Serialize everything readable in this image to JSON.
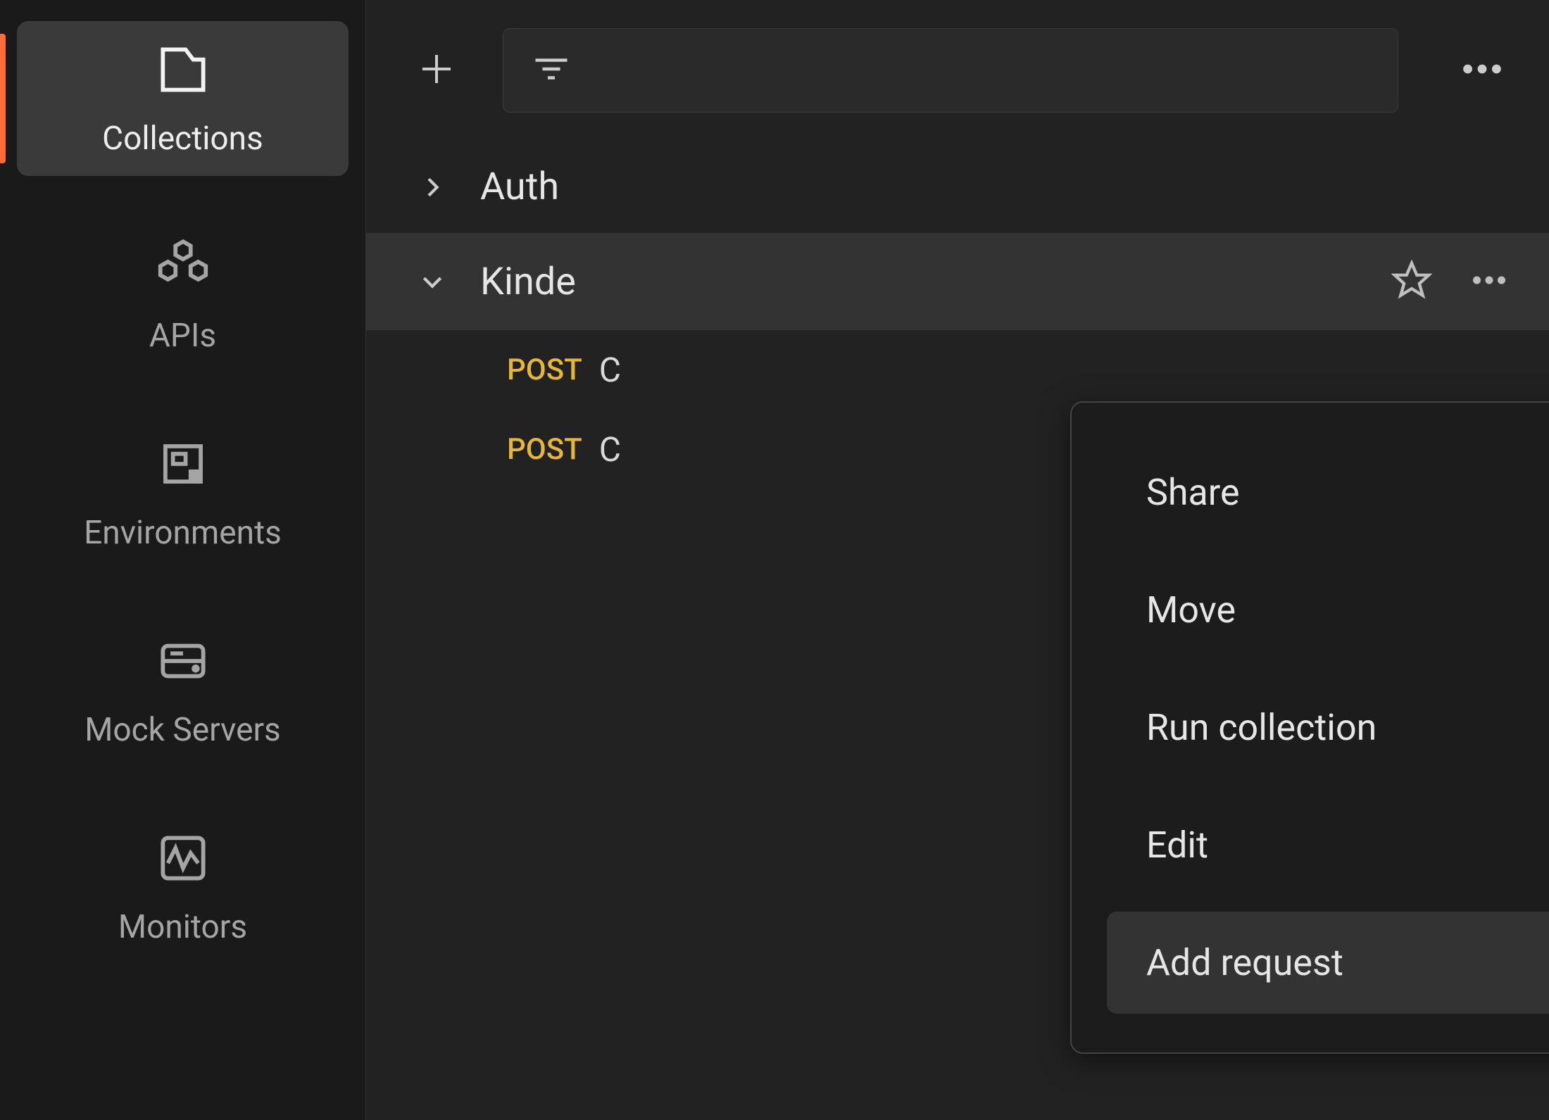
{
  "sidebar": {
    "items": [
      {
        "label": "Collections"
      },
      {
        "label": "APIs"
      },
      {
        "label": "Environments"
      },
      {
        "label": "Mock Servers"
      },
      {
        "label": "Monitors"
      }
    ]
  },
  "toolbar": {
    "search_placeholder": ""
  },
  "tree": {
    "items": [
      {
        "label": "Auth",
        "expanded": false
      },
      {
        "label": "Kinde",
        "expanded": true
      }
    ],
    "requests": [
      {
        "method": "POST",
        "name": "C"
      },
      {
        "method": "POST",
        "name": "C"
      }
    ]
  },
  "context_menu": {
    "items": [
      {
        "label": "Share"
      },
      {
        "label": "Move"
      },
      {
        "label": "Run collection"
      },
      {
        "label": "Edit"
      },
      {
        "label": "Add request"
      }
    ]
  }
}
